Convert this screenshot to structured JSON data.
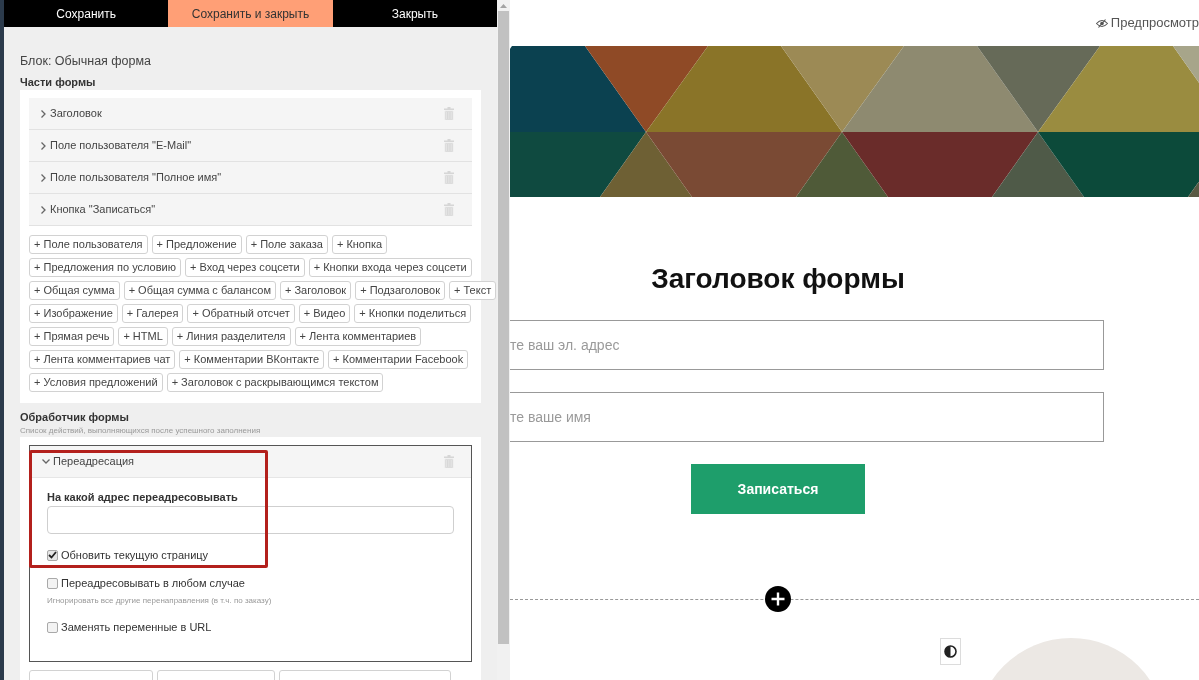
{
  "toolbar": {
    "buttons": [
      {
        "label": "Сохранить",
        "kind": "plain"
      },
      {
        "label": "Сохранить и закрыть",
        "kind": "accent"
      },
      {
        "label": "Закрыть",
        "kind": "plain"
      }
    ]
  },
  "editor": {
    "block_title": "Блок: Обычная форма",
    "form_parts": {
      "title": "Части формы",
      "items": [
        {
          "label": "Заголовок",
          "expanded": false
        },
        {
          "label": "Поле пользователя \"E-Mail\"",
          "expanded": false
        },
        {
          "label": "Поле пользователя \"Полное имя\"",
          "expanded": false
        },
        {
          "label": "Кнопка \"Записаться\"",
          "expanded": false
        }
      ],
      "add_buttons": [
        [
          "+ Поле пользователя",
          "+ Предложение",
          "+ Поле заказа",
          "+ Кнопка"
        ],
        [
          "+ Предложения по условию",
          "+ Вход через соцсети",
          "+ Кнопки входа через соцсети"
        ],
        [
          "+ Общая сумма",
          "+ Общая сумма с балансом",
          "+ Заголовок",
          "+ Подзаголовок",
          "+ Текст"
        ],
        [
          "+ Изображение",
          "+ Галерея",
          "+ Обратный отсчет",
          "+ Видео",
          "+ Кнопки поделиться"
        ],
        [
          "+ Прямая речь",
          "+ HTML",
          "+ Линия разделителя",
          "+ Лента комментариев"
        ],
        [
          "+ Лента комментариев чат",
          "+ Комментарии ВКонтакте",
          "+ Комментарии Facebook"
        ],
        [
          "+ Условия предложений",
          "+ Заголовок с раскрывающимся текстом"
        ]
      ]
    },
    "form_handler": {
      "title": "Обработчик формы",
      "subtitle": "Список действий, выполняющихся после успешного заполнения",
      "actions": [
        {
          "label": "Переадресация",
          "expanded": true,
          "fields": [
            {
              "kind": "text",
              "label": "На какой адрес переадресовывать"
            },
            {
              "kind": "checkbox",
              "label": "Обновить текущую страницу",
              "checked": true
            },
            {
              "kind": "checkbox",
              "label": "Переадресовывать в любом случае",
              "checked": false,
              "hint": "Игнорировать все другие перенаправления (в т.ч. по заказу)"
            },
            {
              "kind": "checkbox",
              "label": "Заменять переменные в URL",
              "checked": false
            }
          ]
        }
      ]
    }
  },
  "preview": {
    "link": "Предпросмотр",
    "heading": "Заголовок формы",
    "inputs": [
      {
        "placeholder": "те ваш эл. адрес"
      },
      {
        "placeholder": "те ваше имя"
      }
    ],
    "submit": "Записаться"
  }
}
